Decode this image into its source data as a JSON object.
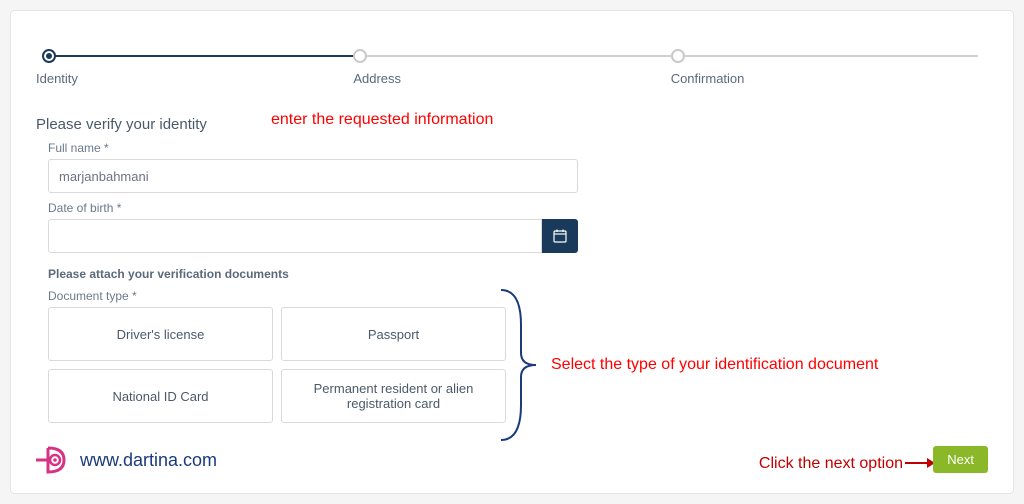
{
  "steps": {
    "s1": "Identity",
    "s2": "Address",
    "s3": "Confirmation"
  },
  "form": {
    "heading": "Please verify your identity",
    "fullname_label": "Full name *",
    "fullname_value": "marjanbahmani",
    "dob_label": "Date of birth *",
    "attach_label": "Please attach your verification documents",
    "doctype_label": "Document type *",
    "docs": {
      "d1": "Driver's license",
      "d2": "Passport",
      "d3": "National ID Card",
      "d4": "Permanent resident or alien registration card"
    }
  },
  "annotations": {
    "a1": "enter the requested information",
    "a2": "Select the type of your identification document",
    "a3": "Click the next option"
  },
  "next_label": "Next",
  "brand_url": "www.dartina.com"
}
